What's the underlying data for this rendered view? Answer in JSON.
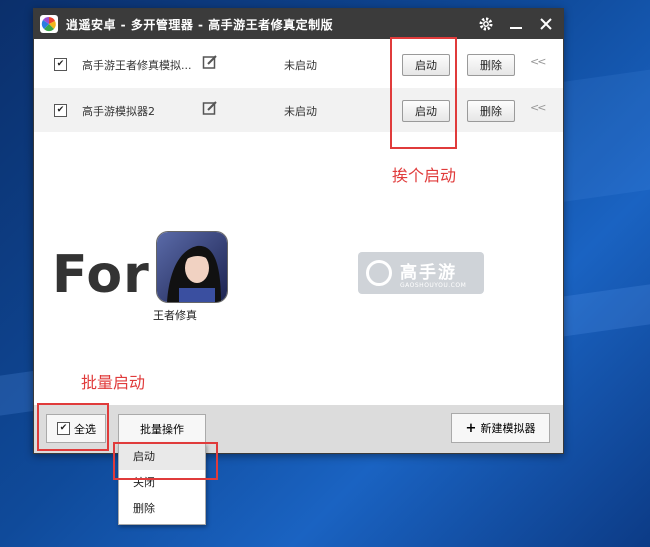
{
  "window": {
    "title": "逍遥安卓 - 多开管理器 - 高手游王者修真定制版",
    "settings_icon": "gear-icon",
    "minimize_icon": "minimize-icon",
    "close_icon": "close-icon"
  },
  "emulators": [
    {
      "checked": true,
      "name": "高手游王者修真模拟...",
      "status": "未启动",
      "start_label": "启动",
      "delete_label": "删除",
      "more": "<<"
    },
    {
      "checked": true,
      "name": "高手游模拟器2",
      "status": "未启动",
      "start_label": "启动",
      "delete_label": "删除",
      "more": "<<"
    }
  ],
  "annotations": {
    "start_each": "挨个启动",
    "batch_start": "批量启动"
  },
  "promo": {
    "for_text": "For",
    "game_name": "王者修真",
    "watermark_text": "高手游",
    "watermark_sub": "GAOSHOUYOU.COM"
  },
  "bottom": {
    "select_all": "全选",
    "batch_ops": "批量操作",
    "new_emulator": "新建模拟器"
  },
  "dropdown": {
    "items": [
      "启动",
      "关闭",
      "删除"
    ]
  },
  "colors": {
    "titlebar": "#3b3b3b",
    "annotation_red": "#e03b3b"
  }
}
